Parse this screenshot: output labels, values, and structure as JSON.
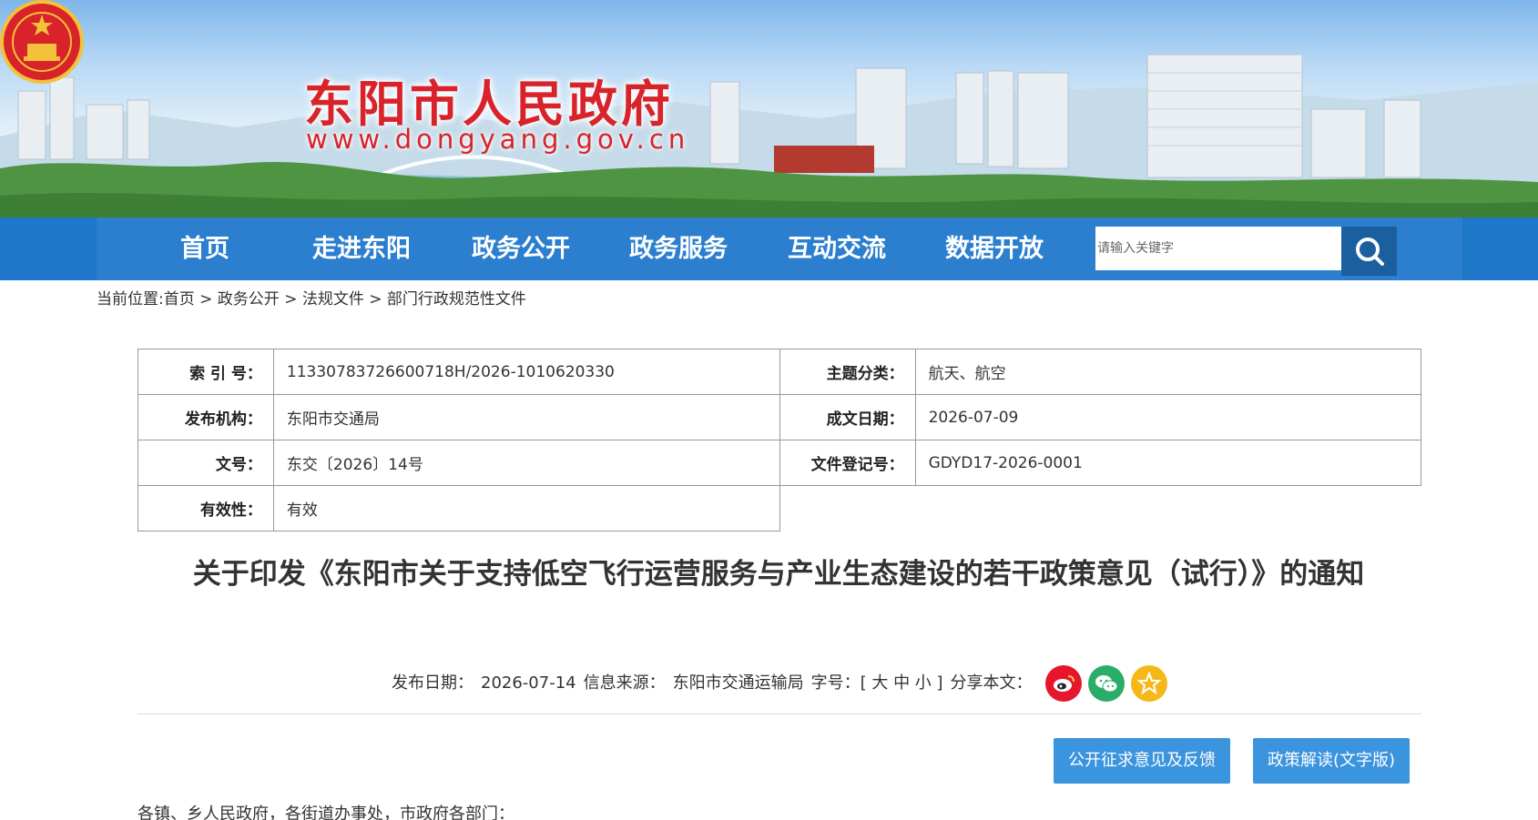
{
  "header": {
    "site_title": "东阳市人民政府",
    "site_url": "www.dongyang.gov.cn"
  },
  "nav": {
    "items": [
      "首页",
      "走进东阳",
      "政务公开",
      "政务服务",
      "互动交流",
      "数据开放"
    ],
    "search_placeholder": "请输入关键字"
  },
  "breadcrumb": {
    "prefix": "当前位置:",
    "items": [
      "首页",
      "政务公开",
      "法规文件",
      "部门行政规范性文件"
    ],
    "separator": " > "
  },
  "info": {
    "index_label": "索 引 号：",
    "index_value": "11330783726600718H/2026-1010620330",
    "topic_label": "主题分类：",
    "topic_value": "航天、航空",
    "issuer_label": "发布机构：",
    "issuer_value": "东阳市交通局",
    "date_label": "成文日期：",
    "date_value": "2026-07-09",
    "docno_label": "文号：",
    "docno_value": "东交〔2026〕14号",
    "regno_label": "文件登记号：",
    "regno_value": "GDYD17-2026-0001",
    "validity_label": "有效性：",
    "validity_value": "有效"
  },
  "document": {
    "title": "关于印发《东阳市关于支持低空飞行运营服务与产业生态建设的若干政策意见（试行）》的通知",
    "publish_label": "发布日期：",
    "publish_date": "2026-07-14",
    "source_label": "信息来源：",
    "source_value": "东阳市交通运输局",
    "font_label": "字号：[ 大 中 小 ]",
    "share_label": "分享本文：",
    "feedback_button": "公开征求意见及反馈",
    "interpretation_button": "政策解读(文字版)",
    "salutation": "各镇、乡人民政府，各街道办事处，市政府各部门："
  },
  "colors": {
    "nav_bg": "#2b7fce",
    "title_red": "#d8232a",
    "button_blue": "#3b94de",
    "weibo_red": "#e6162d",
    "wechat_green": "#2aae67",
    "star_yellow": "#f5b819"
  }
}
